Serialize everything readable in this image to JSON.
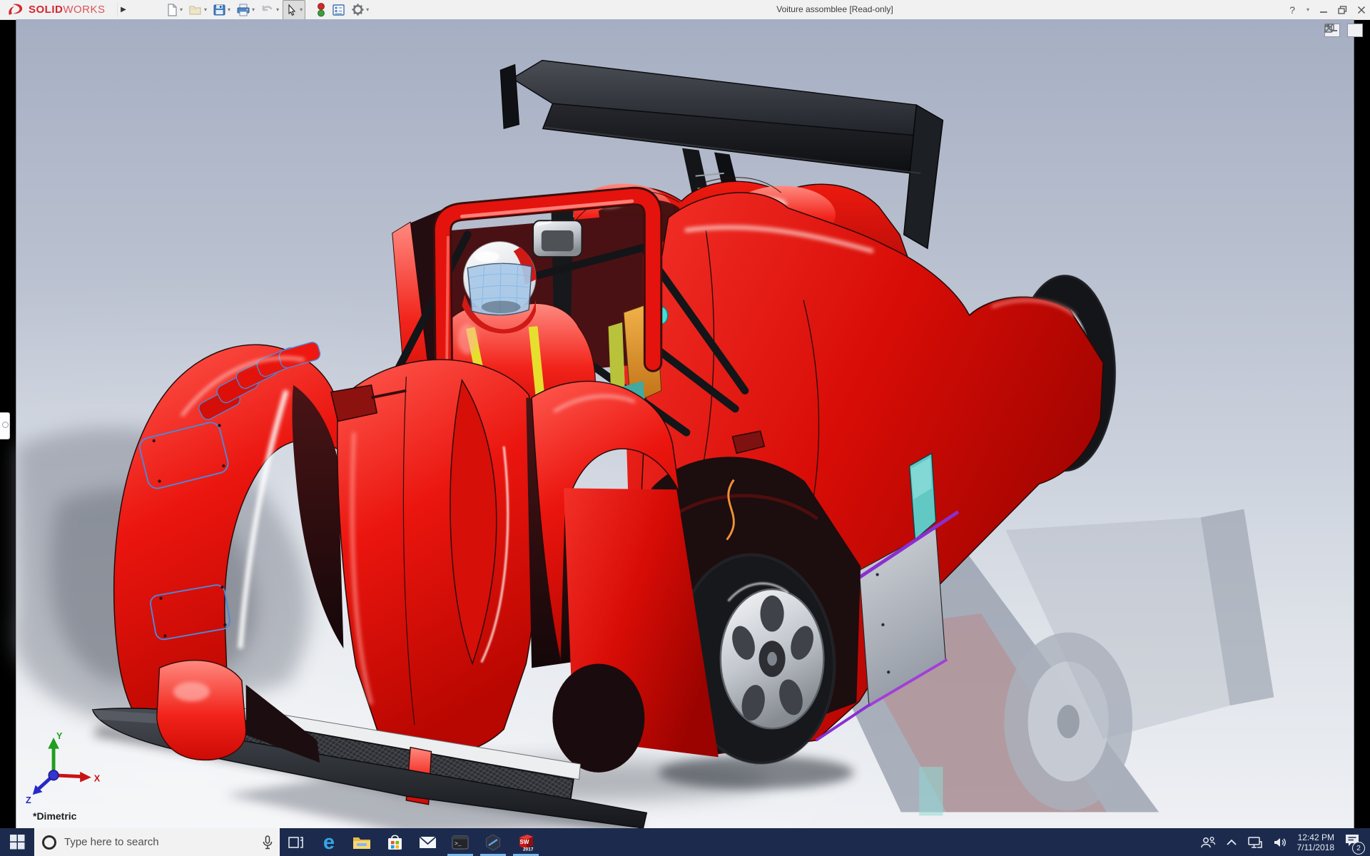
{
  "window": {
    "title": "Voiture assomblee [Read-only]",
    "help_glyph": "?"
  },
  "brand": {
    "bold": "SOLID",
    "light": "WORKS"
  },
  "toolbar": {
    "items": [
      "new-document",
      "open",
      "save",
      "print",
      "undo",
      "select",
      "rebuild",
      "file-properties",
      "options"
    ]
  },
  "document_controls": [
    "previous-pane",
    "next-pane",
    "minimize-document",
    "restore-document",
    "close-document"
  ],
  "viewport": {
    "orientation_label": "*Dimetric",
    "triad_labels": {
      "x": "X",
      "y": "Y",
      "z": "Z"
    },
    "model": "red race car assembly with rear wing, driver and helmet"
  },
  "taskbar": {
    "search_placeholder": "Type here to search",
    "edge_glyph": "e",
    "cmd_glyph": ">_",
    "sw_letters": "SW",
    "solidworks_icon_year": "2017",
    "app_icons": [
      "task-view",
      "microsoft-edge",
      "file-explorer",
      "microsoft-store",
      "mail",
      "command-prompt",
      "edrawings",
      "solidworks-2017"
    ],
    "running_apps": [
      "command-prompt",
      "edrawings",
      "solidworks-2017"
    ],
    "tray": {
      "time": "12:42 PM",
      "date": "7/11/2018",
      "notifications_badge": "2"
    }
  },
  "colors": {
    "car_body_red": "#e8120c",
    "wing_black": "#1b1d20",
    "background_top": "#a6aec3",
    "background_bottom": "#eef0f4",
    "taskbar_navy": "#1c2b4d",
    "running_indicator": "#7ab8ea",
    "brand_red": "#d22630",
    "edge_line_blue": "#4f86d6",
    "visor_blue": "#a9c9e8"
  }
}
